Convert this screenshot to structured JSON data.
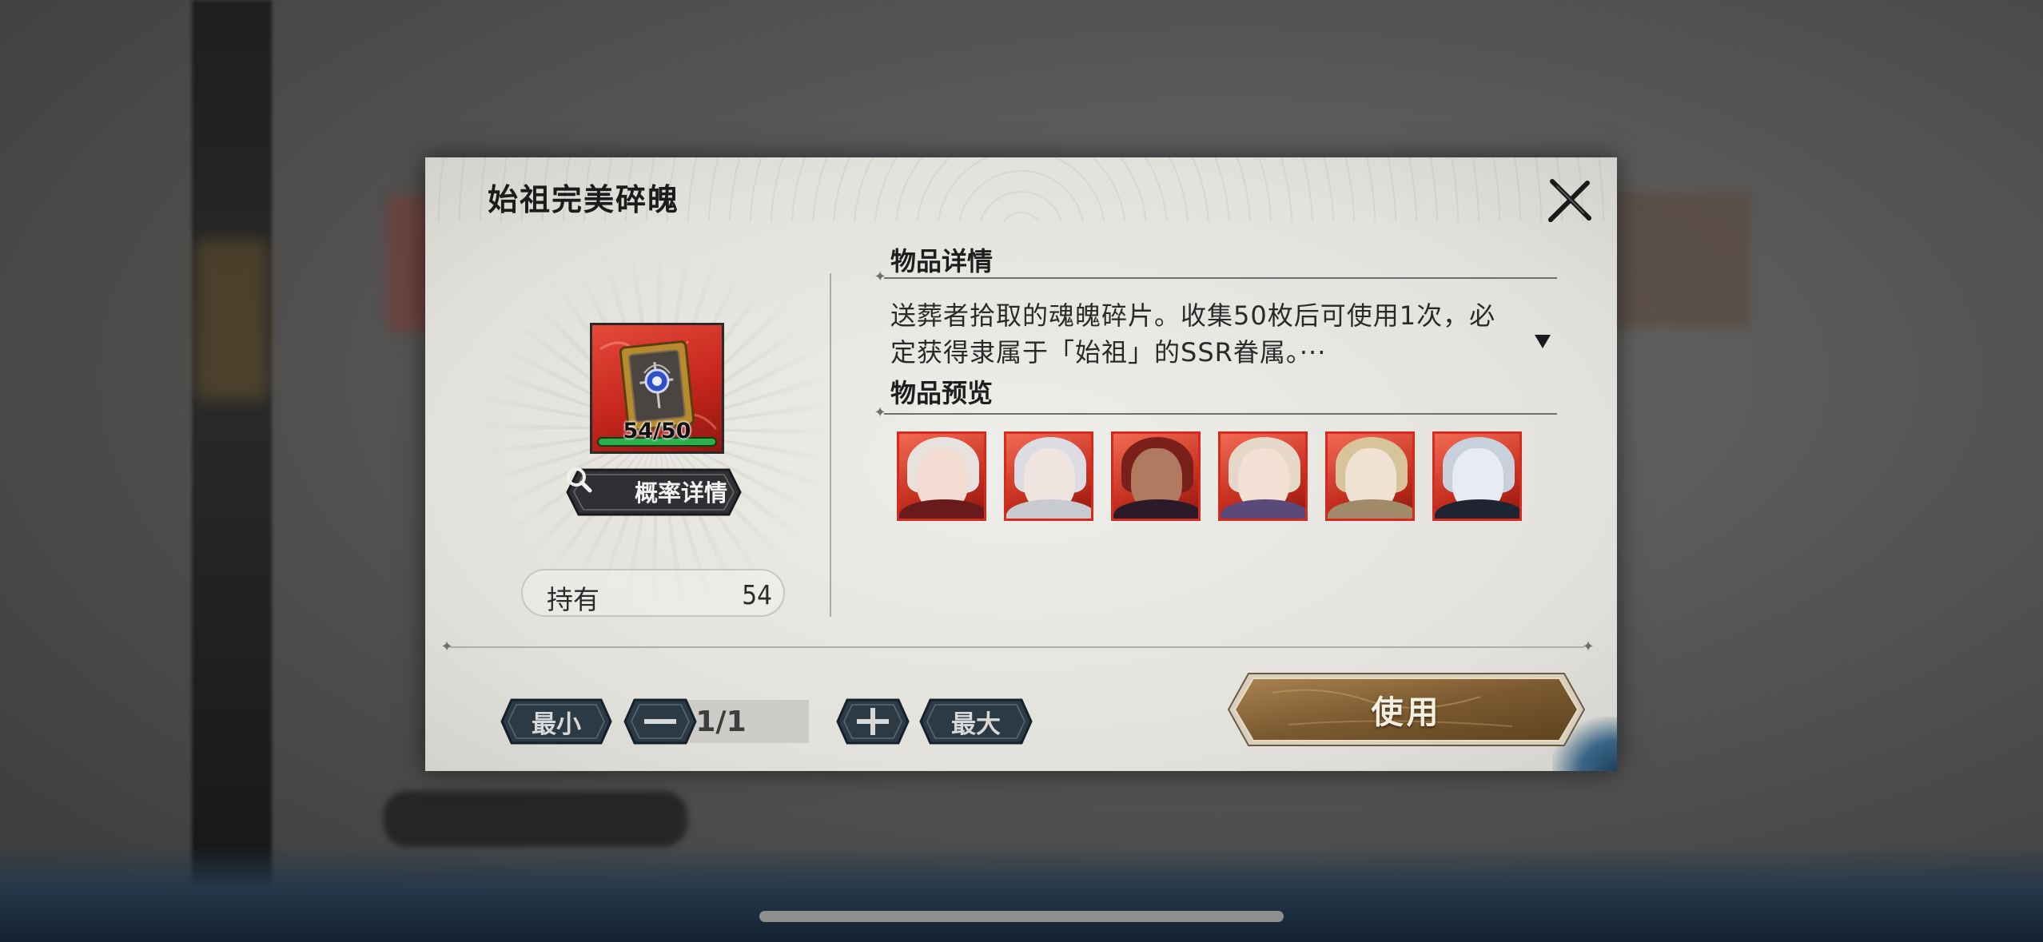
{
  "modal": {
    "title": "始祖完美碎魄",
    "close_icon": "close-x-icon"
  },
  "item": {
    "icon": "soul-fragment-book-icon",
    "count_display": "54/50",
    "progress": 1.0,
    "odds_button_label": "概率详情",
    "odds_icon": "magnifier-icon",
    "owned_label": "持有",
    "owned_value": "54"
  },
  "details": {
    "title": "物品详情",
    "description_line1": "送葬者拾取的魂魄碎片。收集50枚后可使用1次，必",
    "description_line2": "定获得隶属于「始祖」的SSR眷属。···",
    "expand_icon": "chevron-down-icon"
  },
  "preview": {
    "title": "物品预览",
    "portraits": [
      {
        "name": "portrait-1"
      },
      {
        "name": "portrait-2"
      },
      {
        "name": "portrait-3"
      },
      {
        "name": "portrait-4"
      },
      {
        "name": "portrait-5"
      },
      {
        "name": "portrait-6"
      }
    ]
  },
  "controls": {
    "min_label": "最小",
    "minus_icon": "minus-icon",
    "counter": "1/1",
    "plus_icon": "plus-icon",
    "max_label": "最大",
    "use_label": "使用"
  },
  "colors": {
    "accent_red": "#d32b1d",
    "progress_green": "#2ab24a",
    "use_button_gold": "#8a6a3a",
    "dark_button": "#2b3a45"
  }
}
